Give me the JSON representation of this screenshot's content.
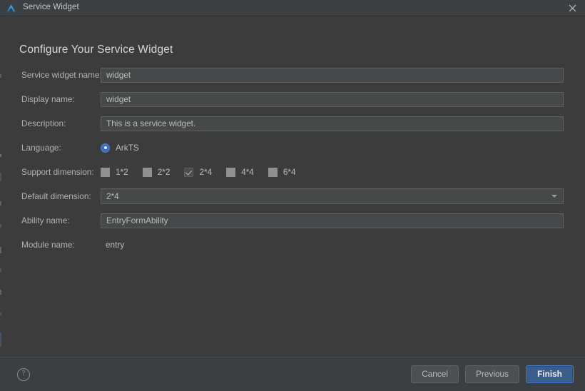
{
  "window": {
    "title": "Service Widget",
    "logo_icon": "deveco-logo-icon",
    "close_icon": "close-icon"
  },
  "heading": "Configure Your Service Widget",
  "form": {
    "rows": [
      {
        "label": "Service widget name:",
        "type": "text",
        "value": "widget",
        "name": "service-widget-name"
      },
      {
        "label": "Display name:",
        "type": "text",
        "value": "widget",
        "name": "display-name"
      },
      {
        "label": "Description:",
        "type": "text",
        "value": "This is a service widget.",
        "name": "description"
      },
      {
        "label": "Language:",
        "type": "radio",
        "name": "language"
      },
      {
        "label": "Support dimension:",
        "type": "checkbox-group",
        "name": "support-dimension"
      },
      {
        "label": "Default dimension:",
        "type": "combo",
        "value": "2*4",
        "name": "default-dimension"
      },
      {
        "label": "Ability name:",
        "type": "text",
        "value": "EntryFormAbility",
        "name": "ability-name"
      },
      {
        "label": "Module name:",
        "type": "static",
        "value": "entry",
        "name": "module-name"
      }
    ],
    "language": {
      "options": [
        {
          "label": "ArkTS",
          "selected": true
        }
      ]
    },
    "support_dimension": {
      "options": [
        {
          "label": "1*2",
          "checked": false
        },
        {
          "label": "2*2",
          "checked": false
        },
        {
          "label": "2*4",
          "checked": true
        },
        {
          "label": "4*4",
          "checked": false
        },
        {
          "label": "6*4",
          "checked": false
        }
      ]
    },
    "default_dimension": {
      "selected": "2*4",
      "dropdown_icon": "chevron-down-icon"
    }
  },
  "footer": {
    "help_icon": "question-mark-icon",
    "help_glyph": "?",
    "buttons": [
      {
        "label": "Cancel",
        "name": "cancel-button",
        "primary": false
      },
      {
        "label": "Previous",
        "name": "previous-button",
        "primary": false
      },
      {
        "label": "Finish",
        "name": "finish-button",
        "primary": true
      }
    ]
  },
  "colors": {
    "dialog_bg": "#3c3c3c",
    "titlebar_bg": "#3c4043",
    "footer_bg": "#3c3f41",
    "input_bg": "#45494a",
    "input_border": "#5e6060",
    "text": "#bbbbbb",
    "heading_text": "#d6d6d6",
    "accent_blue": "#3d6ec4",
    "primary_button_bg": "#3b5e8c",
    "primary_button_border": "#4b7fd4"
  }
}
